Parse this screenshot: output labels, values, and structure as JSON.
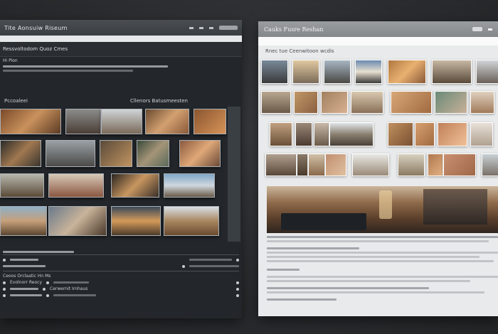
{
  "dark_window": {
    "title": "Tite Aonsuiw Riseum",
    "section_label": "Ressvoltodom Quoz Cmes",
    "toolbar_label": "Hi Pion",
    "gallery_left": "Pccoaleei",
    "gallery_right": "Cllenors Batusmeesten",
    "footer_heading": "Ceoos Orclaatic Hn Ms",
    "footer_items": [
      "Evolnorr Reocy",
      "Cerwernit Irnhaus"
    ]
  },
  "light_window": {
    "title": "Cauks Fusre Reshan",
    "section_label": "Rnec tue Ceenwitoon wcdis"
  },
  "colors": {
    "dark_bg": "#23272b",
    "light_bg": "#e9eaeb",
    "backdrop": "#2e3134"
  }
}
